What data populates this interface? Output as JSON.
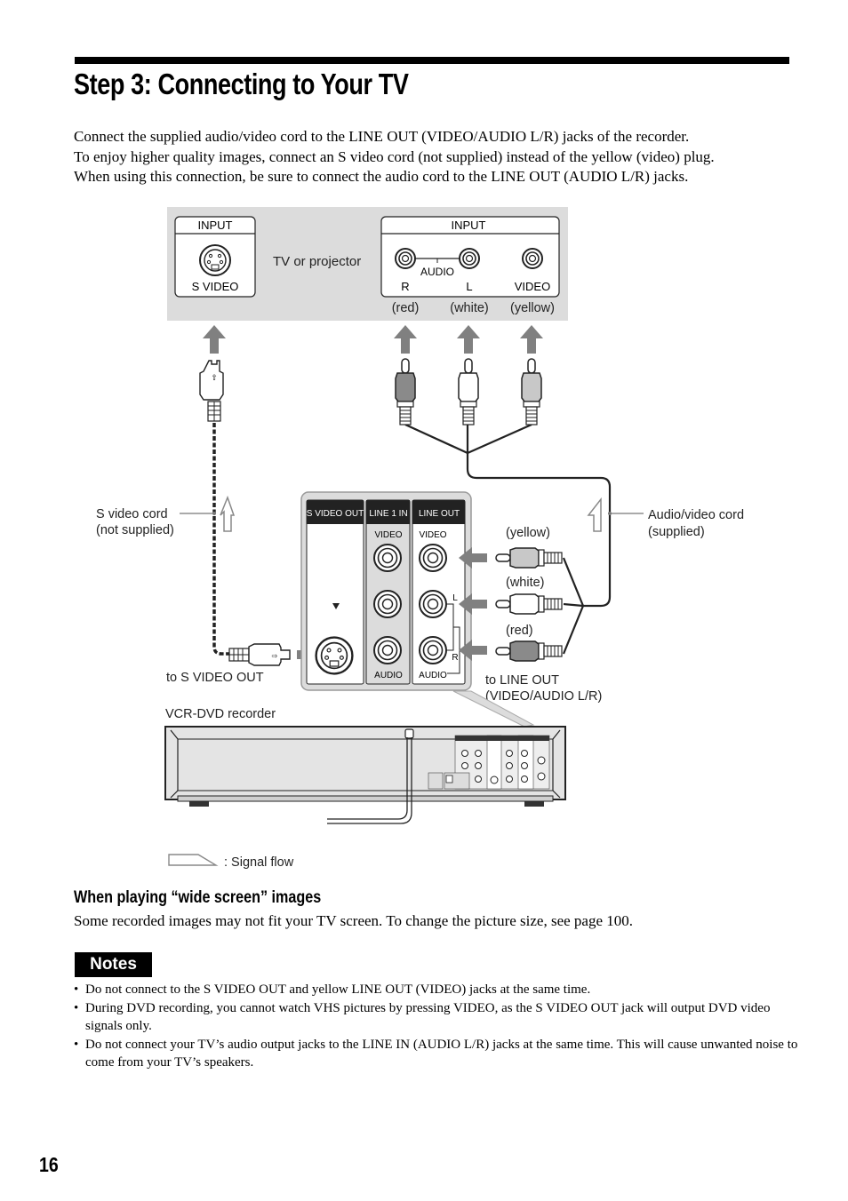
{
  "page": {
    "title": "Step 3: Connecting to Your TV",
    "intro": [
      "Connect the supplied audio/video cord to the LINE OUT (VIDEO/AUDIO L/R) jacks of the recorder.",
      "To enjoy higher quality images, connect an S video cord (not supplied) instead of the yellow (video) plug.",
      "When using this connection, be sure to connect the audio cord to the LINE OUT (AUDIO L/R) jacks."
    ],
    "page_number": "16"
  },
  "diagram": {
    "tv": {
      "label": "TV or projector",
      "svideo_panel": {
        "header": "INPUT",
        "jack_label": "S VIDEO"
      },
      "av_panel": {
        "header": "INPUT",
        "audio_label": "AUDIO",
        "r_label": "R",
        "l_label": "L",
        "video_label": "VIDEO"
      },
      "colors": {
        "red": "(red)",
        "white": "(white)",
        "yellow": "(yellow)"
      }
    },
    "recorder_panel": {
      "sections": [
        "S VIDEO OUT",
        "LINE 1 IN",
        "LINE OUT"
      ],
      "line_in_video": "VIDEO",
      "line_in_audio": "AUDIO",
      "line_out_video": "VIDEO",
      "line_out_audio": "AUDIO",
      "l_label": "L",
      "r_label": "R"
    },
    "labels": {
      "svideo_cord": [
        "S video cord",
        "(not supplied)"
      ],
      "av_cord": [
        "Audio/video cord",
        "(supplied)"
      ],
      "to_svideo_out": "to S VIDEO OUT",
      "to_line_out": [
        "to LINE OUT",
        "(VIDEO/AUDIO L/R)"
      ],
      "plug_yellow": "(yellow)",
      "plug_white": "(white)",
      "plug_red": "(red)",
      "recorder": "VCR-DVD recorder",
      "legend": ": Signal flow"
    },
    "plug_colors": {
      "red": "#8a8a8a",
      "white": "#ffffff",
      "yellow": "#c8c8c8"
    },
    "panel_bg": "#dcdcdc",
    "arrow_color": "#808080"
  },
  "section": {
    "heading": "When playing “wide screen” images",
    "body": "Some recorded images may not fit your TV screen. To change the picture size, see page 100."
  },
  "notes": {
    "badge": "Notes",
    "items": [
      "Do not connect to the S VIDEO OUT and yellow LINE OUT (VIDEO) jacks at the same time.",
      "During DVD recording, you cannot watch VHS pictures by pressing VIDEO, as the S VIDEO OUT jack will output DVD video signals only.",
      "Do not connect your TV’s audio output jacks to the LINE IN (AUDIO L/R) jacks at the same time. This will cause unwanted noise to come from your TV’s speakers."
    ]
  }
}
